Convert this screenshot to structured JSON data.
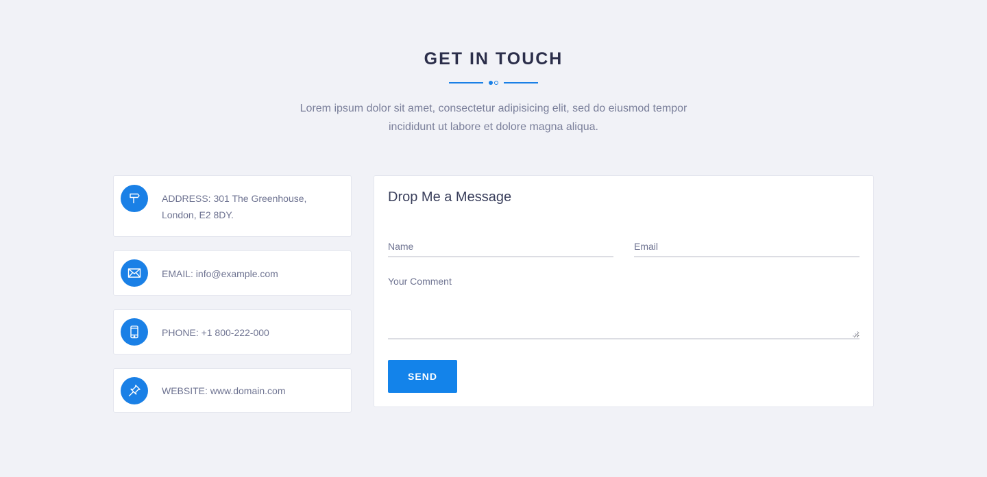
{
  "section": {
    "title": "GET IN TOUCH",
    "subtitle": "Lorem ipsum dolor sit amet, consectetur adipisicing elit, sed do eiusmod tempor incididunt ut labore et dolore magna aliqua."
  },
  "contact_info": {
    "address": {
      "icon": "signpost-icon",
      "text": "ADDRESS: 301 The Greenhouse, London, E2 8DY."
    },
    "email": {
      "icon": "envelope-icon",
      "text": "EMAIL: info@example.com"
    },
    "phone": {
      "icon": "mobile-phone-icon",
      "text": "PHONE: +1 800-222-000"
    },
    "website": {
      "icon": "pushpin-icon",
      "text": "WEBSITE: www.domain.com"
    }
  },
  "form": {
    "title": "Drop Me a Message",
    "name_placeholder": "Name",
    "email_placeholder": "Email",
    "comment_placeholder": "Your Comment",
    "send_label": "SEND"
  },
  "colors": {
    "accent": "#1a80e6",
    "background": "#f1f2f7",
    "heading": "#2b2e4a",
    "body_text": "#7a7f9a"
  }
}
